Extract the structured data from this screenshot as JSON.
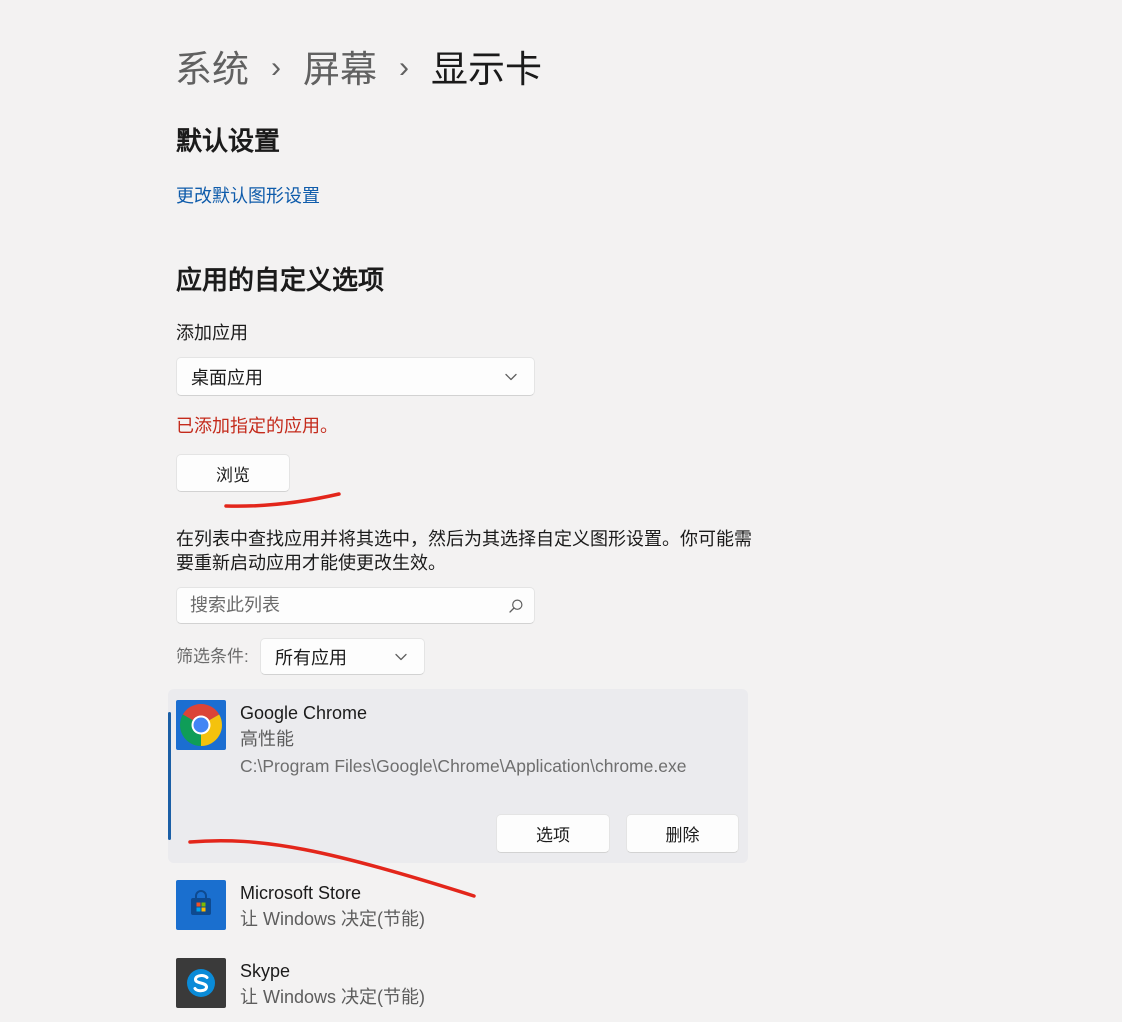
{
  "breadcrumb": {
    "items": [
      "系统",
      "屏幕",
      "显示卡"
    ],
    "separator": "›"
  },
  "default_settings": {
    "heading": "默认设置",
    "change_default_link": "更改默认图形设置"
  },
  "custom_options": {
    "heading": "应用的自定义选项",
    "add_app_label": "添加应用",
    "app_type_selected": "桌面应用",
    "status_message": "已添加指定的应用。",
    "browse_button": "浏览",
    "description": "在列表中查找应用并将其选中，然后为其选择自定义图形设置。你可能需要重新启动应用才能使更改生效。",
    "search_placeholder": "搜索此列表",
    "filter_label": "筛选条件:",
    "filter_selected": "所有应用"
  },
  "apps": [
    {
      "name": "Google Chrome",
      "preference": "高性能",
      "path": "C:\\Program Files\\Google\\Chrome\\Application\\chrome.exe",
      "icon": "chrome-icon",
      "expanded": true,
      "options_button": "选项",
      "remove_button": "删除"
    },
    {
      "name": "Microsoft Store",
      "preference": "让 Windows 决定(节能)",
      "icon": "microsoft-store-icon"
    },
    {
      "name": "Skype",
      "preference": "让 Windows 决定(节能)",
      "icon": "skype-icon"
    }
  ],
  "icons": {
    "dropdown": "chevron-down-icon",
    "search": "search-icon"
  },
  "colors": {
    "background": "#f3f2f2",
    "accent": "#0f5cab",
    "error": "#c42b1c",
    "annotation": "#e3261b",
    "selected_card": "#ebebee",
    "selection_indicator": "#1b5fa6"
  }
}
